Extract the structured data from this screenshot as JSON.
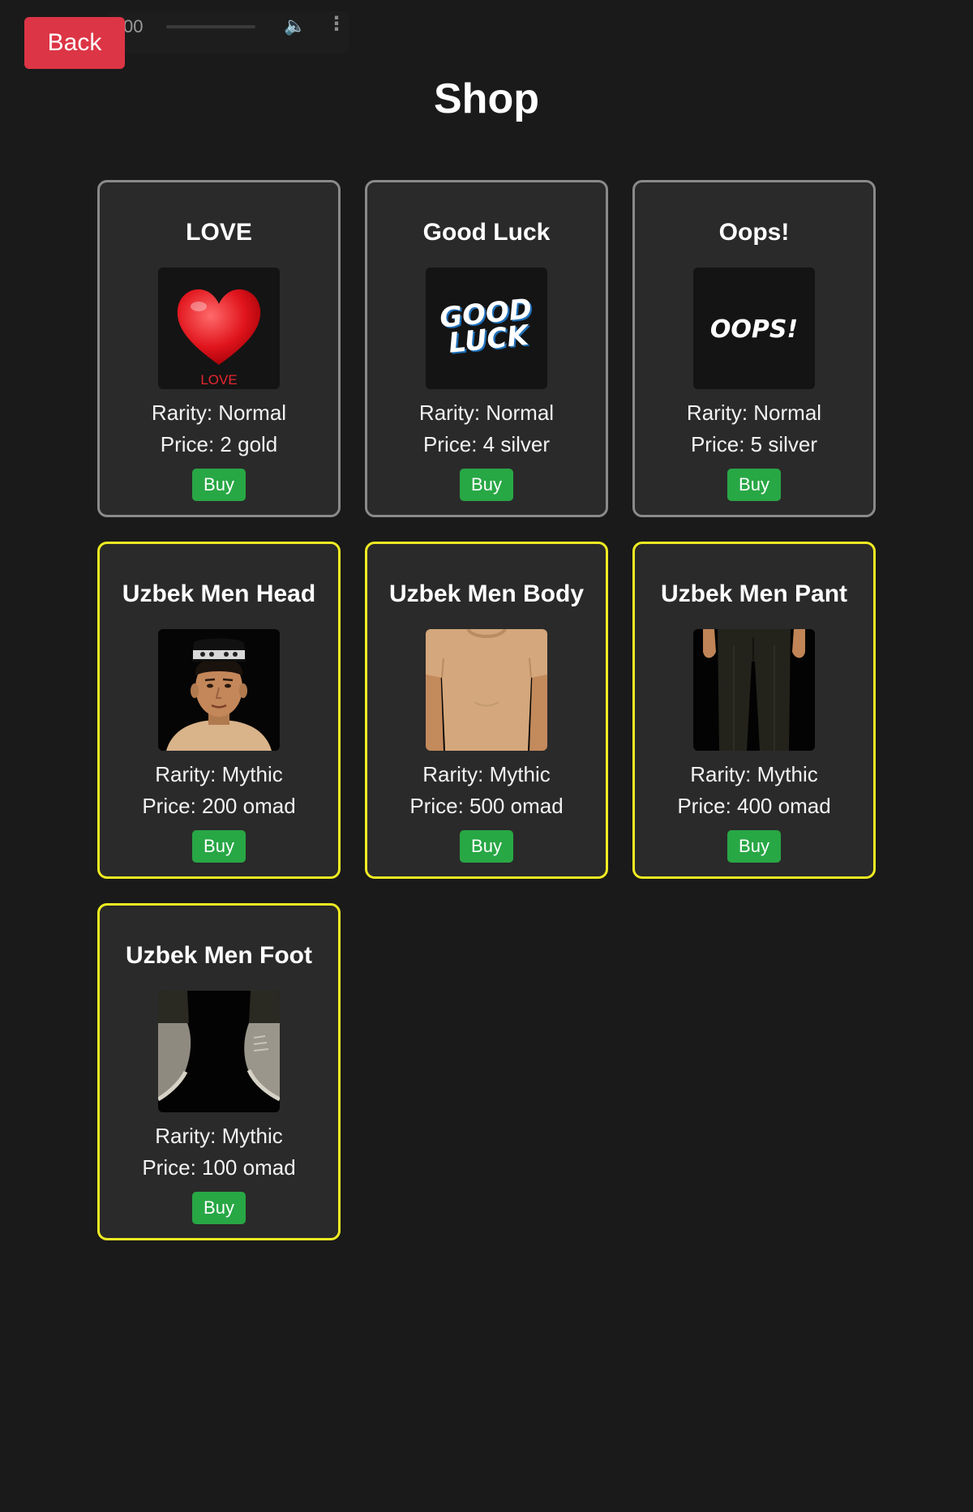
{
  "audio": {
    "time": "00"
  },
  "header": {
    "back_label": "Back",
    "title": "Shop"
  },
  "rarity_prefix": "Rarity: ",
  "price_prefix": "Price: ",
  "items": [
    {
      "name": "LOVE",
      "rarity": "Normal",
      "price": "2 gold",
      "buy_label": "Buy",
      "image_caption": "LOVE",
      "icon": "heart-icon"
    },
    {
      "name": "Good Luck",
      "rarity": "Normal",
      "price": "4 silver",
      "buy_label": "Buy",
      "image_caption": "GOOD LUCK",
      "icon": "good-luck-text-icon"
    },
    {
      "name": "Oops!",
      "rarity": "Normal",
      "price": "5 silver",
      "buy_label": "Buy",
      "image_caption": "OOPS!",
      "icon": "oops-text-icon"
    },
    {
      "name": "Uzbek Men Head",
      "rarity": "Mythic",
      "price": "200 omad",
      "buy_label": "Buy",
      "icon": "head-avatar-icon"
    },
    {
      "name": "Uzbek Men Body",
      "rarity": "Mythic",
      "price": "500 omad",
      "buy_label": "Buy",
      "icon": "tshirt-body-icon"
    },
    {
      "name": "Uzbek Men Pant",
      "rarity": "Mythic",
      "price": "400 omad",
      "buy_label": "Buy",
      "icon": "pants-icon"
    },
    {
      "name": "Uzbek Men Foot",
      "rarity": "Mythic",
      "price": "100 omad",
      "buy_label": "Buy",
      "icon": "shoes-icon"
    }
  ],
  "colors": {
    "background": "#1a1a1a",
    "card": "#2a2a2a",
    "normal_border": "#8a8a8a",
    "mythic_border": "#f0ec22",
    "back_button": "#dc3545",
    "buy_button": "#28a745"
  }
}
